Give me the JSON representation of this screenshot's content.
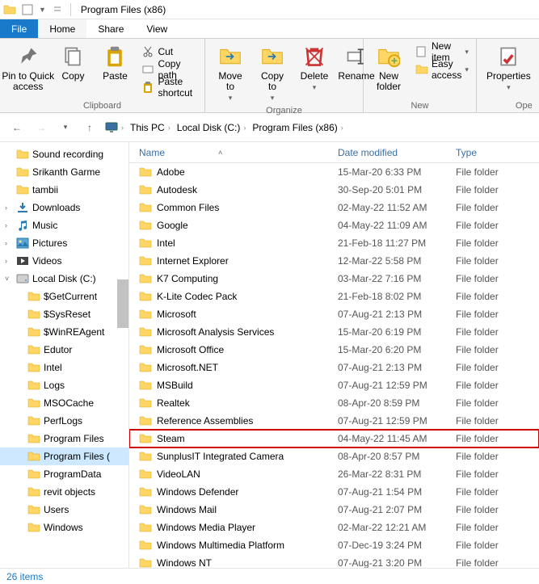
{
  "window": {
    "title": "Program Files (x86)"
  },
  "tabs": {
    "file": "File",
    "home": "Home",
    "share": "Share",
    "view": "View"
  },
  "ribbon": {
    "clipboard": {
      "label": "Clipboard",
      "pin": "Pin to Quick\naccess",
      "copy": "Copy",
      "paste": "Paste",
      "cut": "Cut",
      "copy_path": "Copy path",
      "paste_shortcut": "Paste shortcut"
    },
    "organize": {
      "label": "Organize",
      "move_to": "Move\nto",
      "copy_to": "Copy\nto",
      "delete": "Delete",
      "rename": "Rename"
    },
    "new": {
      "label": "New",
      "new_folder": "New\nfolder",
      "new_item": "New item",
      "easy_access": "Easy access"
    },
    "open": {
      "label": "Ope",
      "properties": "Properties"
    }
  },
  "breadcrumb": [
    "This PC",
    "Local Disk (C:)",
    "Program Files (x86)"
  ],
  "tree": [
    {
      "label": "Sound recording",
      "icon": "folder",
      "level": 1
    },
    {
      "label": "Srikanth Garme",
      "icon": "folder",
      "level": 1
    },
    {
      "label": "tambii",
      "icon": "folder",
      "level": 1
    },
    {
      "label": "Downloads",
      "icon": "downloads",
      "level": 1,
      "expandable": true
    },
    {
      "label": "Music",
      "icon": "music",
      "level": 1,
      "expandable": true
    },
    {
      "label": "Pictures",
      "icon": "pictures",
      "level": 1,
      "expandable": true
    },
    {
      "label": "Videos",
      "icon": "videos",
      "level": 1,
      "expandable": true
    },
    {
      "label": "Local Disk (C:)",
      "icon": "disk",
      "level": 1,
      "expanded": true
    },
    {
      "label": "$GetCurrent",
      "icon": "folder",
      "level": 2
    },
    {
      "label": "$SysReset",
      "icon": "folder",
      "level": 2
    },
    {
      "label": "$WinREAgent",
      "icon": "folder",
      "level": 2
    },
    {
      "label": "Edutor",
      "icon": "folder",
      "level": 2
    },
    {
      "label": "Intel",
      "icon": "folder",
      "level": 2
    },
    {
      "label": "Logs",
      "icon": "folder",
      "level": 2
    },
    {
      "label": "MSOCache",
      "icon": "folder",
      "level": 2
    },
    {
      "label": "PerfLogs",
      "icon": "folder",
      "level": 2
    },
    {
      "label": "Program Files",
      "icon": "folder",
      "level": 2
    },
    {
      "label": "Program Files (",
      "icon": "folder",
      "level": 2,
      "selected": true
    },
    {
      "label": "ProgramData",
      "icon": "folder",
      "level": 2
    },
    {
      "label": "revit objects",
      "icon": "folder",
      "level": 2
    },
    {
      "label": "Users",
      "icon": "folder",
      "level": 2
    },
    {
      "label": "Windows",
      "icon": "folder",
      "level": 2
    }
  ],
  "columns": {
    "name": "Name",
    "date": "Date modified",
    "type": "Type"
  },
  "rows": [
    {
      "name": "Adobe",
      "date": "15-Mar-20 6:33 PM",
      "type": "File folder"
    },
    {
      "name": "Autodesk",
      "date": "30-Sep-20 5:01 PM",
      "type": "File folder"
    },
    {
      "name": "Common Files",
      "date": "02-May-22 11:52 AM",
      "type": "File folder"
    },
    {
      "name": "Google",
      "date": "04-May-22 11:09 AM",
      "type": "File folder"
    },
    {
      "name": "Intel",
      "date": "21-Feb-18 11:27 PM",
      "type": "File folder"
    },
    {
      "name": "Internet Explorer",
      "date": "12-Mar-22 5:58 PM",
      "type": "File folder"
    },
    {
      "name": "K7 Computing",
      "date": "03-Mar-22 7:16 PM",
      "type": "File folder"
    },
    {
      "name": "K-Lite Codec Pack",
      "date": "21-Feb-18 8:02 PM",
      "type": "File folder"
    },
    {
      "name": "Microsoft",
      "date": "07-Aug-21 2:13 PM",
      "type": "File folder"
    },
    {
      "name": "Microsoft Analysis Services",
      "date": "15-Mar-20 6:19 PM",
      "type": "File folder"
    },
    {
      "name": "Microsoft Office",
      "date": "15-Mar-20 6:20 PM",
      "type": "File folder"
    },
    {
      "name": "Microsoft.NET",
      "date": "07-Aug-21 2:13 PM",
      "type": "File folder"
    },
    {
      "name": "MSBuild",
      "date": "07-Aug-21 12:59 PM",
      "type": "File folder"
    },
    {
      "name": "Realtek",
      "date": "08-Apr-20 8:59 PM",
      "type": "File folder"
    },
    {
      "name": "Reference Assemblies",
      "date": "07-Aug-21 12:59 PM",
      "type": "File folder"
    },
    {
      "name": "Steam",
      "date": "04-May-22 11:45 AM",
      "type": "File folder",
      "highlight": true
    },
    {
      "name": "SunplusIT Integrated Camera",
      "date": "08-Apr-20 8:57 PM",
      "type": "File folder"
    },
    {
      "name": "VideoLAN",
      "date": "26-Mar-22 8:31 PM",
      "type": "File folder"
    },
    {
      "name": "Windows Defender",
      "date": "07-Aug-21 1:54 PM",
      "type": "File folder"
    },
    {
      "name": "Windows Mail",
      "date": "07-Aug-21 2:07 PM",
      "type": "File folder"
    },
    {
      "name": "Windows Media Player",
      "date": "02-Mar-22 12:21 AM",
      "type": "File folder"
    },
    {
      "name": "Windows Multimedia Platform",
      "date": "07-Dec-19 3:24 PM",
      "type": "File folder"
    },
    {
      "name": "Windows NT",
      "date": "07-Aug-21 3:20 PM",
      "type": "File folder"
    }
  ],
  "status": "26 items"
}
